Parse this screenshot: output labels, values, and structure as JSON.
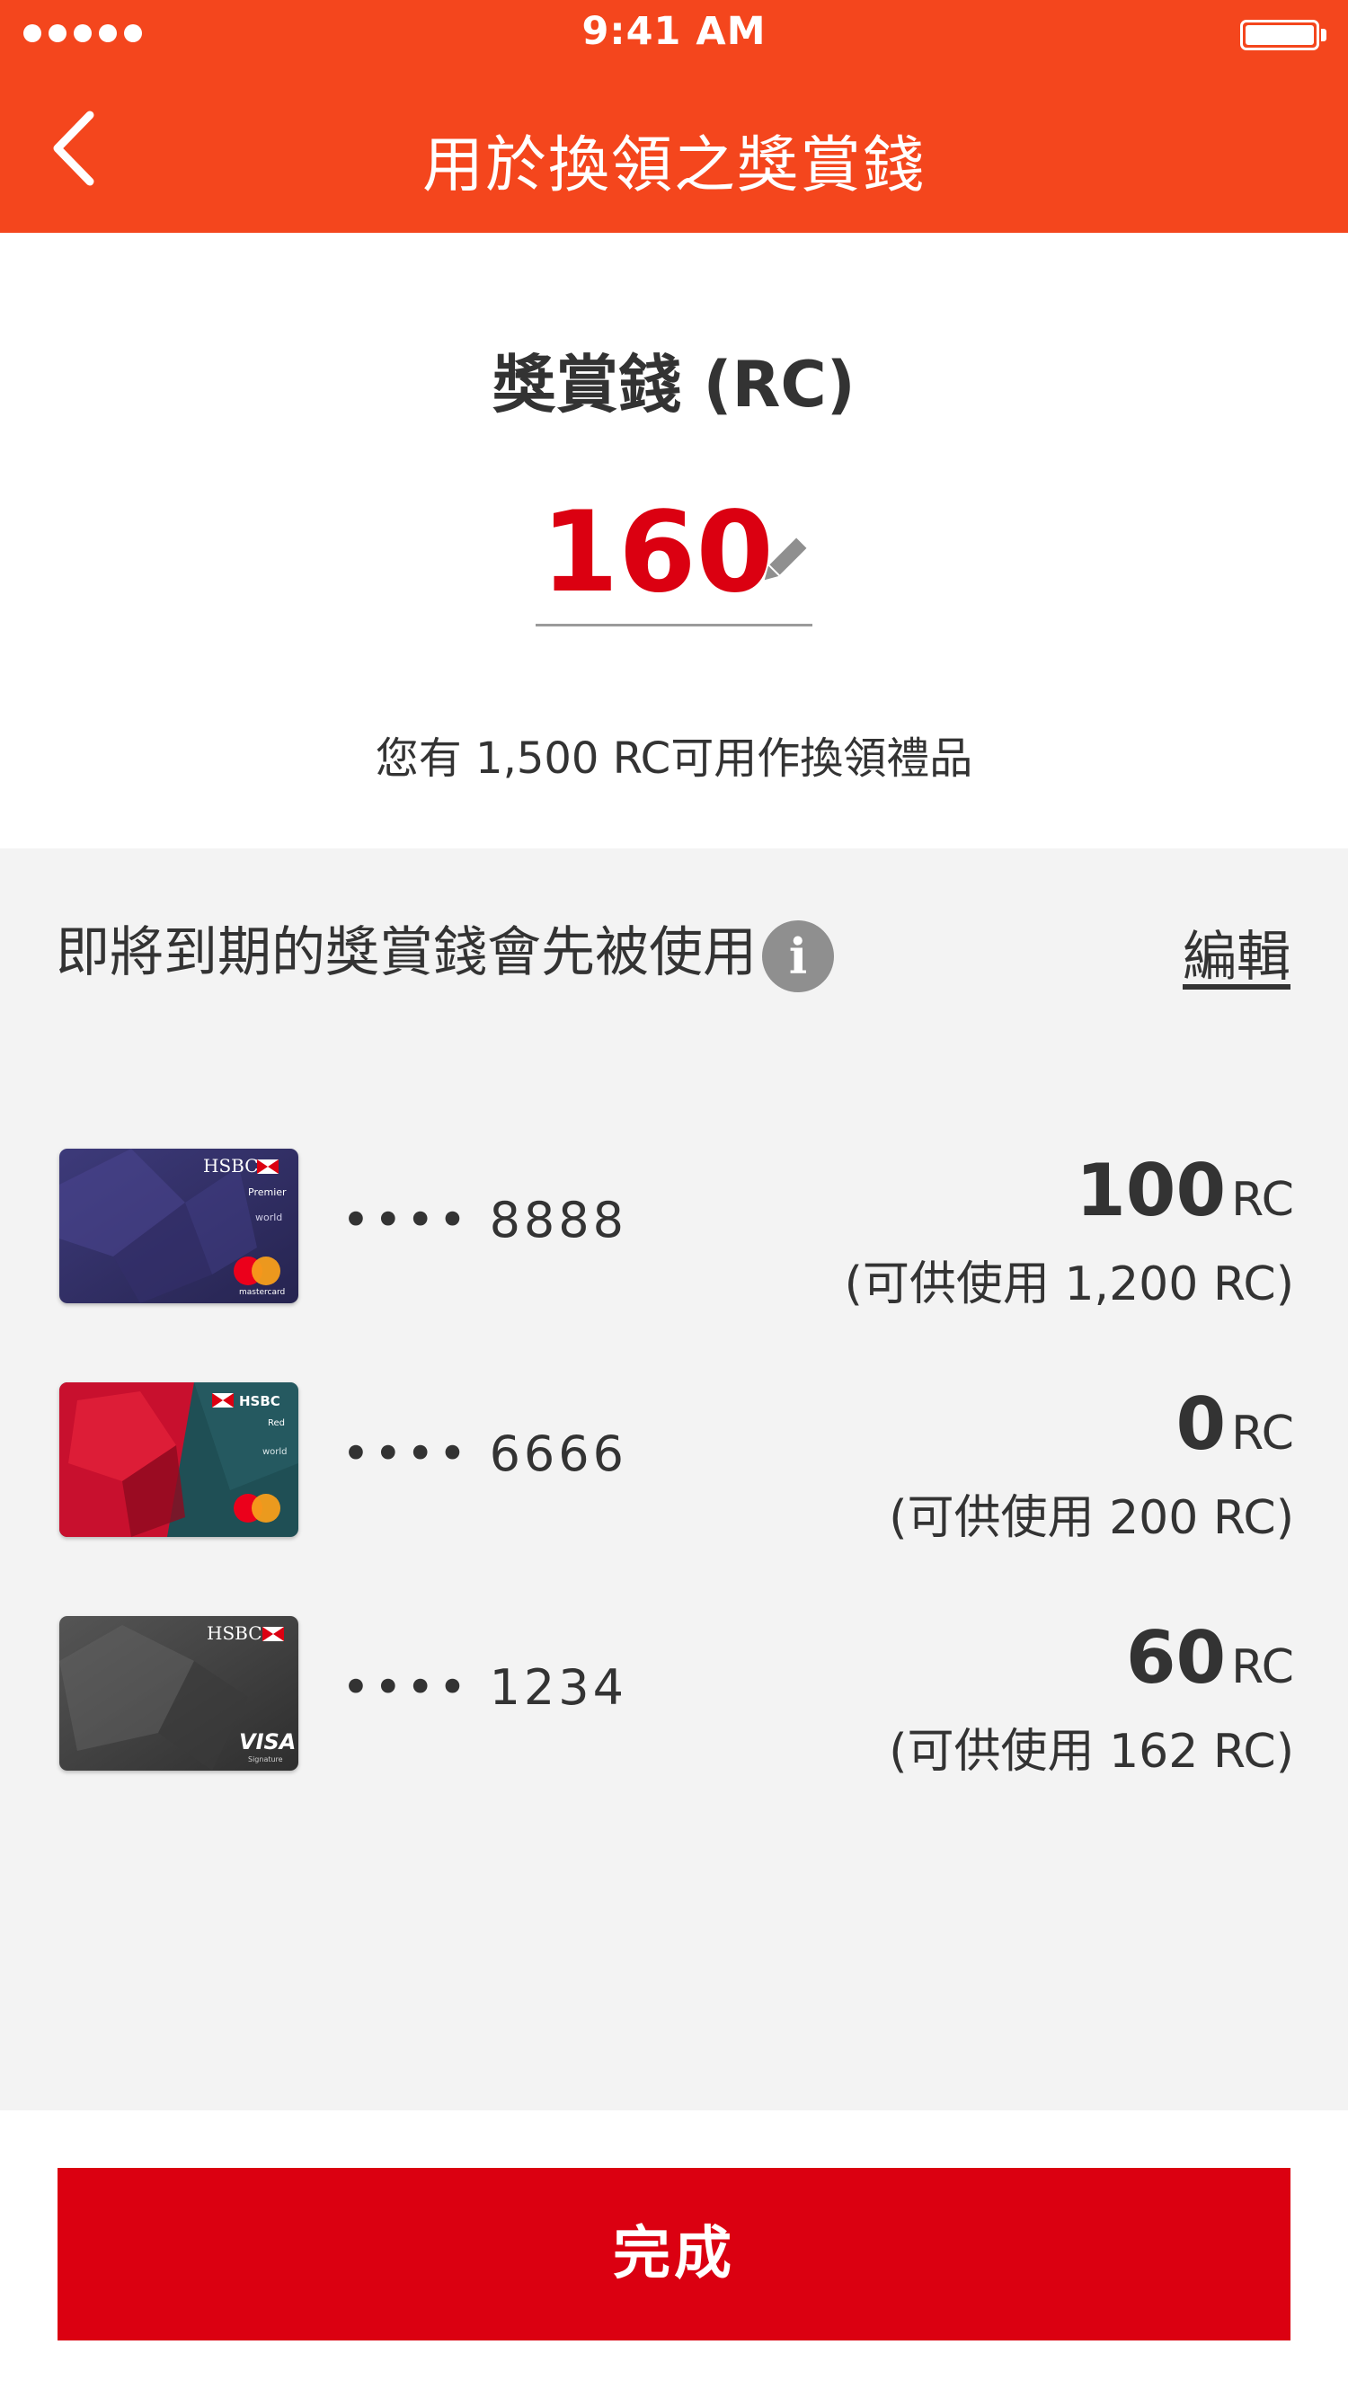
{
  "status_bar": {
    "time": "9:41 AM",
    "signal_icon": "signal-dots-icon",
    "battery_icon": "battery-icon"
  },
  "nav": {
    "back_icon": "chevron-left-icon",
    "title": "用於換領之獎賞錢"
  },
  "rc": {
    "label": "獎賞錢 (RC)",
    "value": "160",
    "edit_icon": "pencil-icon",
    "available_text": "您有 1,500 RC可用作換領禮品"
  },
  "cards_section": {
    "heading": "即將到期的獎賞錢會先被使用",
    "info_icon": "info-icon",
    "edit_label": "編輯",
    "cards": [
      {
        "number": "•••• 8888",
        "amount": "100",
        "unit": "RC",
        "available": "(可供使用 1,200 RC)",
        "card_art": "hsbc-premier-mastercard"
      },
      {
        "number": "•••• 6666",
        "amount": "0",
        "unit": "RC",
        "available": "(可供使用 200 RC)",
        "card_art": "hsbc-red-mastercard"
      },
      {
        "number": "•••• 1234",
        "amount": "60",
        "unit": "RC",
        "available": "(可供使用 162 RC)",
        "card_art": "hsbc-visa-signature"
      }
    ]
  },
  "cta": {
    "done_label": "完成"
  },
  "colors": {
    "header": "#f4461d",
    "accent_red": "#db0011",
    "panel_bg": "#f3f3f3",
    "text": "#333333"
  }
}
